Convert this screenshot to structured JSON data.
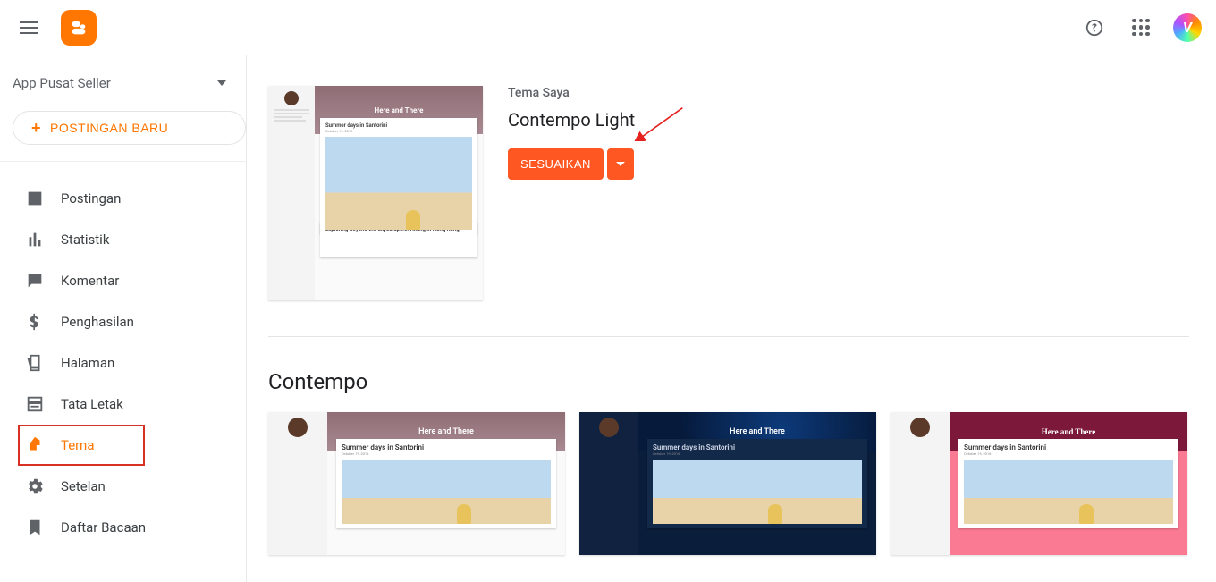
{
  "blog_name": "App Pusat Seller",
  "new_post_label": "POSTINGAN BARU",
  "nav": {
    "posts": "Postingan",
    "stats": "Statistik",
    "comments": "Komentar",
    "earnings": "Penghasilan",
    "pages": "Halaman",
    "layout": "Tata Letak",
    "theme": "Tema",
    "settings": "Setelan",
    "reading_list": "Daftar Bacaan"
  },
  "theme": {
    "label": "Tema Saya",
    "name": "Contempo Light",
    "customize": "SESUAIKAN"
  },
  "preview": {
    "hero_title": "Here and There",
    "card_title": "Summer days in Santorini",
    "card_title2": "Exploring Beyond the Skyscrapers: Hiking in Hong Kong"
  },
  "section": {
    "contempo": "Contempo"
  }
}
